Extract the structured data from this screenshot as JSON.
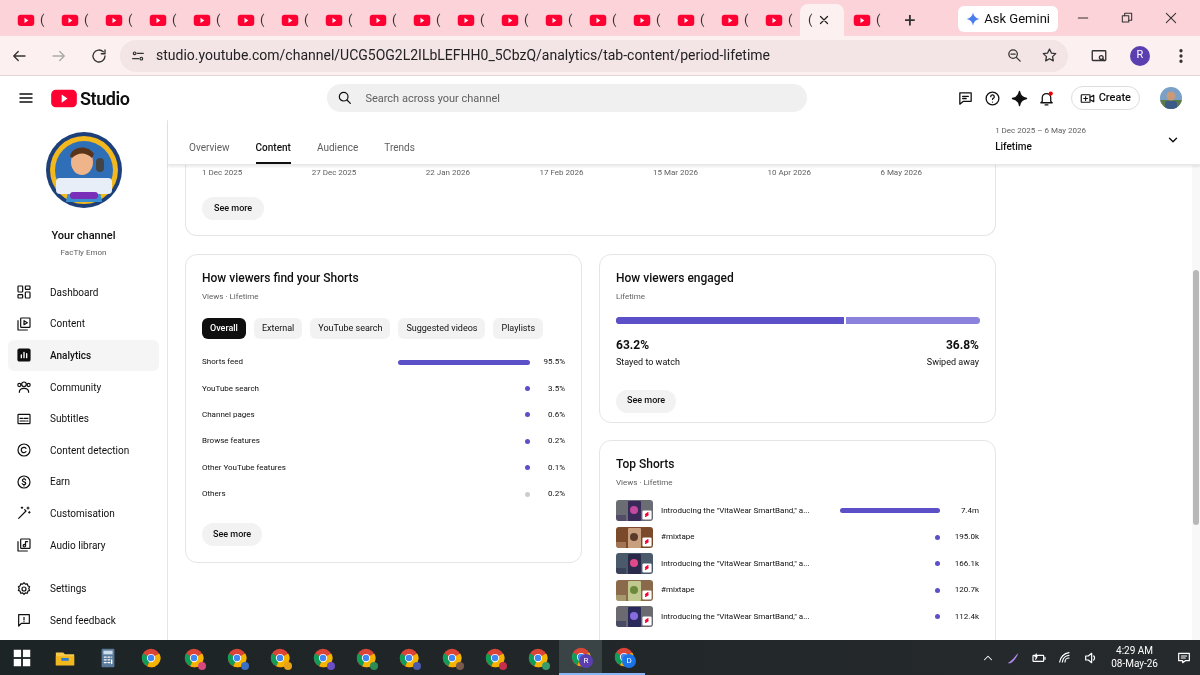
{
  "browser": {
    "tabs": [
      {
        "title": "(",
        "selected": false
      },
      {
        "title": "(",
        "selected": false
      },
      {
        "title": "(",
        "selected": false
      },
      {
        "title": "(",
        "selected": false
      },
      {
        "title": "(",
        "selected": false
      },
      {
        "title": "(",
        "selected": false
      },
      {
        "title": "(",
        "selected": false
      },
      {
        "title": "(",
        "selected": false
      },
      {
        "title": "(",
        "selected": false
      },
      {
        "title": "(",
        "selected": false
      },
      {
        "title": "(",
        "selected": false
      },
      {
        "title": "(",
        "selected": false
      },
      {
        "title": "(",
        "selected": false
      },
      {
        "title": "(",
        "selected": false
      },
      {
        "title": "(",
        "selected": false
      },
      {
        "title": "(",
        "selected": false
      },
      {
        "title": "(",
        "selected": false
      },
      {
        "title": "(",
        "selected": false
      },
      {
        "title": "(",
        "selected": true
      },
      {
        "title": "(",
        "selected": false
      }
    ],
    "new_tab": "+",
    "gemini": "Ask Gemini",
    "url": "studio.youtube.com/channel/UCG5OG2L2ILbLEFHH0_5CbzQ/analytics/tab-content/period-lifetime",
    "profile": "R"
  },
  "header": {
    "logo": "Studio",
    "search_placeholder": "Search across your channel",
    "create": "Create"
  },
  "sidebar": {
    "channel_title": "Your channel",
    "channel_name": "FacTly Emon",
    "items": [
      {
        "label": "Dashboard",
        "selected": false
      },
      {
        "label": "Content",
        "selected": false
      },
      {
        "label": "Analytics",
        "selected": true
      },
      {
        "label": "Community",
        "selected": false
      },
      {
        "label": "Subtitles",
        "selected": false
      },
      {
        "label": "Content detection",
        "selected": false
      },
      {
        "label": "Earn",
        "selected": false
      },
      {
        "label": "Customisation",
        "selected": false
      },
      {
        "label": "Audio library",
        "selected": false
      }
    ],
    "footer": [
      {
        "label": "Settings"
      },
      {
        "label": "Send feedback"
      }
    ]
  },
  "tabs": [
    {
      "label": "Overview",
      "selected": false
    },
    {
      "label": "Content",
      "selected": true
    },
    {
      "label": "Audience",
      "selected": false
    },
    {
      "label": "Trends",
      "selected": false
    }
  ],
  "period": {
    "range": "1 Dec 2025 – 6 May 2026",
    "label": "Lifetime"
  },
  "chart_card": {
    "axis_labels": [
      "1 Dec 2025",
      "27 Dec 2025",
      "22 Jan 2026",
      "17 Feb 2026",
      "15 Mar 2026",
      "10 Apr 2026",
      "6 May 2026"
    ],
    "button": "See more"
  },
  "find_card": {
    "title": "How viewers find your Shorts",
    "subtitle": "Views · Lifetime",
    "chips": [
      {
        "label": "Overall",
        "selected": true
      },
      {
        "label": "External",
        "selected": false
      },
      {
        "label": "YouTube search",
        "selected": false
      },
      {
        "label": "Suggested videos",
        "selected": false
      },
      {
        "label": "Playlists",
        "selected": false
      }
    ],
    "rows": [
      {
        "label": "Shorts feed",
        "kind": "bar",
        "value": "95.5%",
        "color": "#5b50c8"
      },
      {
        "label": "YouTube search",
        "kind": "dot",
        "value": "3.5%",
        "color": "#5b50c8"
      },
      {
        "label": "Channel pages",
        "kind": "dot",
        "value": "0.6%",
        "color": "#5b50c8"
      },
      {
        "label": "Browse features",
        "kind": "dot",
        "value": "0.2%",
        "color": "#5b50c8"
      },
      {
        "label": "Other YouTube features",
        "kind": "dot",
        "value": "0.1%",
        "color": "#5b50c8"
      },
      {
        "label": "Others",
        "kind": "dot",
        "value": "0.2%",
        "color": "#cccccc"
      }
    ],
    "button": "See more"
  },
  "engaged_card": {
    "title": "How viewers engaged",
    "subtitle": "Lifetime",
    "level": 0.632,
    "segments": [
      {
        "value": "63.2%",
        "label": "Stayed to watch"
      },
      {
        "value": "36.8%",
        "label": "Swiped away"
      }
    ],
    "button": "See more"
  },
  "top_shorts": {
    "title": "Top Shorts",
    "subtitle": "Views · Lifetime",
    "rows": [
      {
        "title": "Introducing the \"VitaWear SmartBand,\" a...",
        "kind": "bar",
        "value": "7.4m"
      },
      {
        "title": "#mixtape",
        "kind": "dot",
        "value": "195.0k"
      },
      {
        "title": "Introducing the \"VitaWear SmartBand,\" a...",
        "kind": "dot",
        "value": "166.1k"
      },
      {
        "title": "#mixtape",
        "kind": "dot",
        "value": "120.7k"
      },
      {
        "title": "Introducing the \"VitaWear SmartBand,\" a...",
        "kind": "dot",
        "value": "112.4k"
      }
    ]
  },
  "taskbar": {
    "apps": [
      {
        "kind": "windows"
      },
      {
        "kind": "files"
      },
      {
        "kind": "calculator"
      },
      {
        "kind": "chrome"
      },
      {
        "kind": "chrome_profile"
      },
      {
        "kind": "chrome_profile"
      },
      {
        "kind": "chrome_profile"
      },
      {
        "kind": "chrome_profile"
      },
      {
        "kind": "chrome_profile"
      },
      {
        "kind": "chrome_profile"
      },
      {
        "kind": "chrome_profile"
      },
      {
        "kind": "chrome_profile"
      },
      {
        "kind": "chrome_profile"
      },
      {
        "kind": "chrome_profile",
        "badge": "R",
        "selected": true
      },
      {
        "kind": "chrome_profile",
        "badge": "D",
        "selected": false
      }
    ],
    "time": "4:29 AM",
    "date": "08-May-26"
  }
}
